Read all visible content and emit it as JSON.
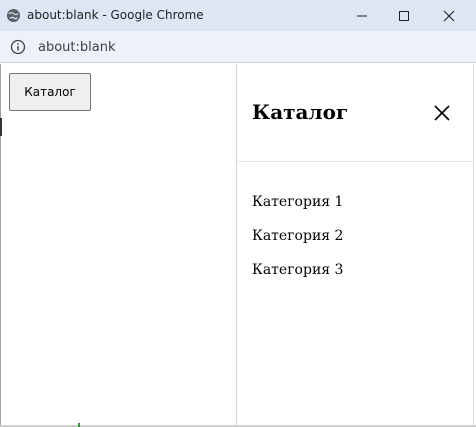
{
  "window": {
    "title": "about:blank - Google Chrome",
    "controls": [
      "minimize",
      "maximize",
      "close"
    ]
  },
  "addressbar": {
    "url": "about:blank"
  },
  "page": {
    "catalog_button_label": "Каталог"
  },
  "offcanvas": {
    "title": "Каталог",
    "items": [
      "Категория 1",
      "Категория 2",
      "Категория 3"
    ]
  },
  "icons": {
    "globe": "globe-icon",
    "info": "info-icon",
    "close": "close-icon",
    "minimize": "minimize-icon",
    "maximize": "maximize-icon"
  },
  "colors": {
    "titlebar": "#dee6f3",
    "addressbar": "#edf2fa",
    "button_bg": "#efefef",
    "text": "#000000"
  }
}
